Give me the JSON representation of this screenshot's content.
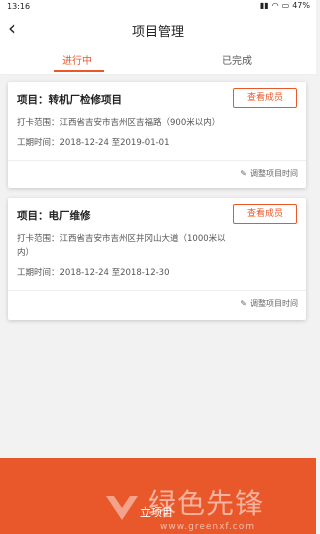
{
  "status_bar": {
    "time": "13:16",
    "battery": "47%"
  },
  "header": {
    "title": "项目管理",
    "back_icon": "back-arrow-icon"
  },
  "tabs": [
    {
      "label": "进行中",
      "active": true
    },
    {
      "label": "已完成",
      "active": false
    }
  ],
  "projects": [
    {
      "title": "项目：转机厂检修项目",
      "view_label": "查看成员",
      "range": "打卡范围：江西省吉安市吉州区吉福路（900米以内）",
      "range_cont": "",
      "period": "工期时间：2018-12-24  至2019-01-01",
      "adjust_label": "调整项目时间"
    },
    {
      "title": "项目：电厂维修",
      "view_label": "查看成员",
      "range": "打卡范围：江西省吉安市吉州区井冈山大道（1000米以",
      "range_cont": "内）",
      "period": "工期时间：2018-12-24  至2018-12-30",
      "adjust_label": "调整项目时间"
    }
  ],
  "bottom": {
    "label": "立项目",
    "watermark": "绿色先锋",
    "watermark_url": "www.greenxf.com"
  },
  "colors": {
    "accent": "#e8582a",
    "background": "#f2f2f2"
  }
}
